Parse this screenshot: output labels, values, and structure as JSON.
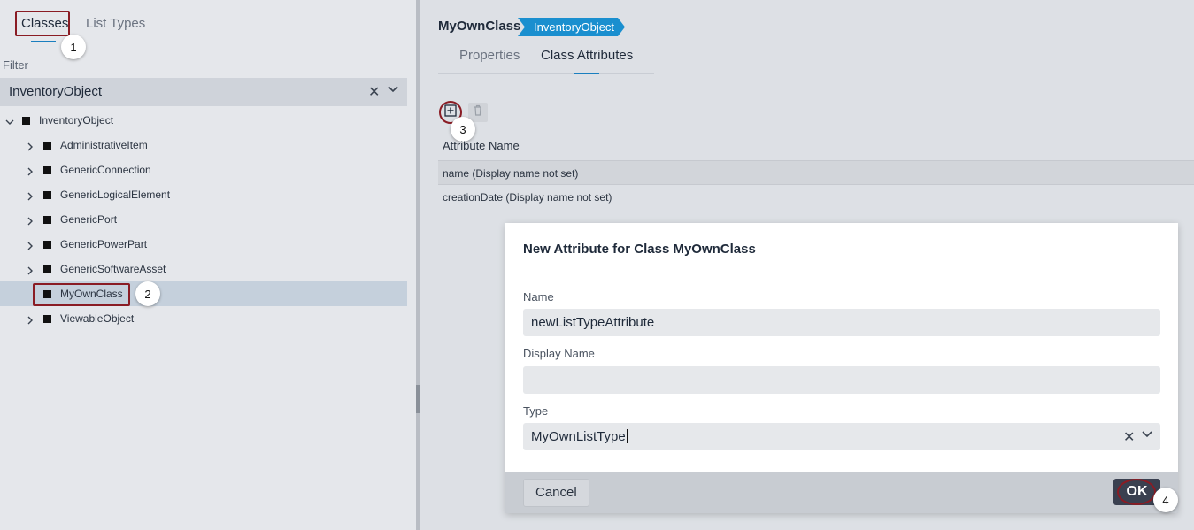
{
  "left_panel": {
    "tabs": [
      {
        "label": "Classes",
        "active": true
      },
      {
        "label": "List Types",
        "active": false
      }
    ],
    "filter": {
      "label": "Filter",
      "value": "InventoryObject"
    },
    "tree": {
      "root": "InventoryObject",
      "children": [
        {
          "label": "AdministrativeItem",
          "expandable": true
        },
        {
          "label": "GenericConnection",
          "expandable": true
        },
        {
          "label": "GenericLogicalElement",
          "expandable": true
        },
        {
          "label": "GenericPort",
          "expandable": true
        },
        {
          "label": "GenericPowerPart",
          "expandable": true
        },
        {
          "label": "GenericSoftwareAsset",
          "expandable": true
        },
        {
          "label": "MyOwnClass",
          "expandable": false,
          "selected": true
        },
        {
          "label": "ViewableObject",
          "expandable": true
        }
      ]
    }
  },
  "right_panel": {
    "class_name": "MyOwnClass",
    "parent_badge": "InventoryObject",
    "tabs": [
      {
        "label": "Properties",
        "active": false
      },
      {
        "label": "Class Attributes",
        "active": true
      }
    ],
    "toolbar": {
      "add_icon": "plus-box-icon",
      "delete_icon": "trash-icon"
    },
    "table": {
      "header": "Attribute Name",
      "rows": [
        "name (Display name not set)",
        "creationDate (Display name not set)"
      ]
    }
  },
  "dialog": {
    "title": "New Attribute for Class MyOwnClass",
    "name_label": "Name",
    "name_value": "newListTypeAttribute",
    "display_name_label": "Display Name",
    "display_name_value": "",
    "type_label": "Type",
    "type_value": "MyOwnListType",
    "cancel_label": "Cancel",
    "ok_label": "OK"
  },
  "callouts": [
    "1",
    "2",
    "3",
    "4"
  ],
  "colors": {
    "accent": "#1a8fcf",
    "callout_border": "#8a1c24",
    "ok_button": "#3a4050"
  }
}
